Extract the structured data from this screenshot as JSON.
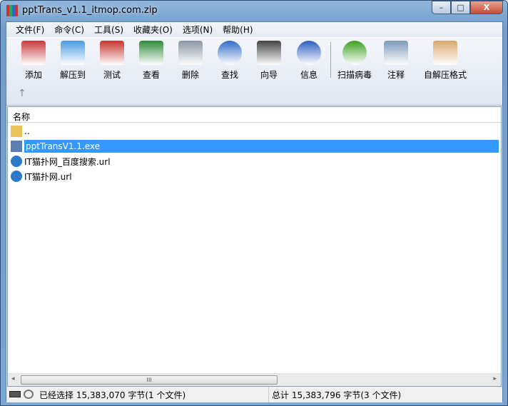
{
  "window": {
    "title": "pptTrans_v1.1_itmop.com.zip",
    "min": "–",
    "max": "□",
    "close": "X"
  },
  "menu": [
    "文件(F)",
    "命令(C)",
    "工具(S)",
    "收藏夹(O)",
    "选项(N)",
    "帮助(H)"
  ],
  "toolbar": [
    {
      "label": "添加",
      "icon": "add-archive-icon",
      "color": "#c83a3a"
    },
    {
      "label": "解压到",
      "icon": "extract-folder-icon",
      "color": "#4a9be0"
    },
    {
      "label": "测试",
      "icon": "test-clipboard-icon",
      "color": "#c8342c"
    },
    {
      "label": "查看",
      "icon": "view-book-icon",
      "color": "#2e8b3a"
    },
    {
      "label": "删除",
      "icon": "trash-icon",
      "color": "#8a96a4"
    },
    {
      "label": "查找",
      "icon": "magnifier-icon",
      "color": "#2f6cc8"
    },
    {
      "label": "向导",
      "icon": "wizard-wand-icon",
      "color": "#444444"
    },
    {
      "label": "信息",
      "icon": "info-icon",
      "color": "#2c5fc0"
    },
    {
      "label": "扫描病毒",
      "icon": "virus-scan-icon",
      "color": "#3aa020"
    },
    {
      "label": "注释",
      "icon": "comment-icon",
      "color": "#7c9ab8"
    },
    {
      "label": "自解压格式",
      "icon": "sfx-box-icon",
      "color": "#d9a86a"
    }
  ],
  "up_arrow": "↑",
  "list": {
    "header": "名称",
    "files": [
      {
        "name": "..",
        "icon": "folder-up-icon"
      },
      {
        "name": "pptTransV1.1.exe",
        "icon": "exe-icon",
        "selected": true
      },
      {
        "name": "IT猫扑网_百度搜索.url",
        "icon": "url-globe-icon"
      },
      {
        "name": "IT猫扑网.url",
        "icon": "url-globe-icon"
      }
    ]
  },
  "scroll": {
    "thumb": "III",
    "left": "◂",
    "right": "▸"
  },
  "status": {
    "selected": "已经选择 15,383,070 字节(1 个文件)",
    "total": "总计 15,383,796 字节(3 个文件)"
  }
}
